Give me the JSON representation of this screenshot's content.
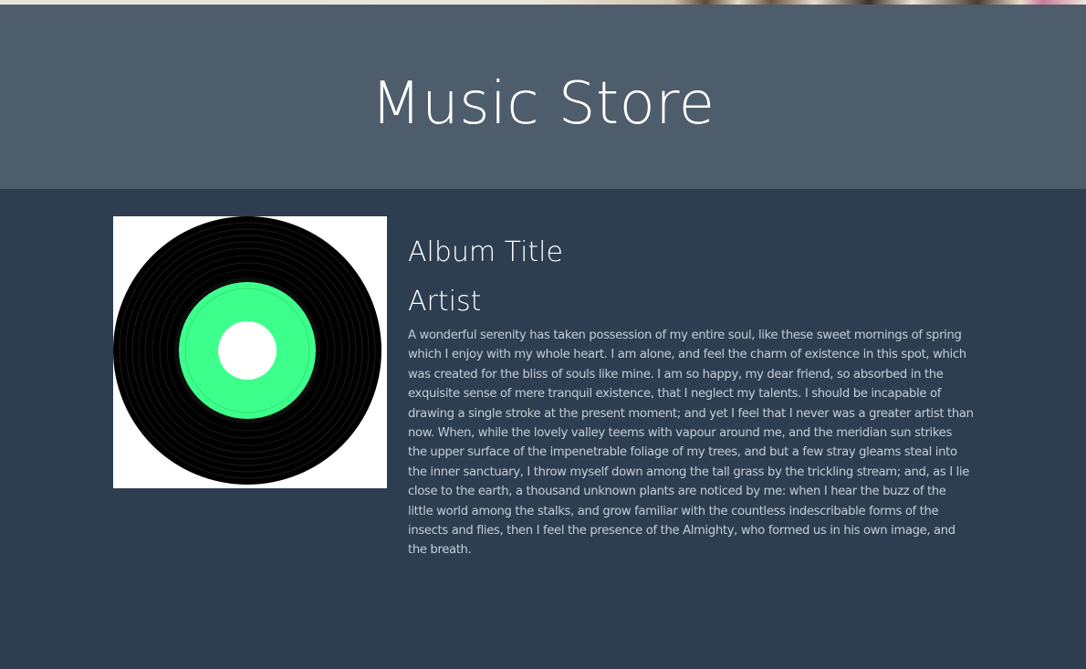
{
  "page": {
    "store_title": "Music Store"
  },
  "album": {
    "title": "Album Title",
    "artist": "Artist",
    "description": "A wonderful serenity has taken possession of my entire soul, like these sweet mornings of spring which I enjoy with my whole heart. I am alone, and feel the charm of existence in this spot, which was created for the bliss of souls like mine. I am so happy, my dear friend, so absorbed in the exquisite sense of mere tranquil existence, that I neglect my talents. I should be incapable of drawing a single stroke at the present moment; and yet I feel that I never was a greater artist than now. When, while the lovely valley teems with vapour around me, and the meridian sun strikes the upper surface of the impenetrable foliage of my trees, and but a few stray gleams steal into the inner sanctuary, I throw myself down among the tall grass by the trickling stream; and, as I lie close to the earth, a thousand unknown plants are noticed by me: when I hear the buzz of the little world among the stalks, and grow familiar with the countless indescribable forms of the insects and flies, then I feel the presence of the Almighty, who formed us in his own image, and the breath.",
    "cover_icon": "vinyl-record-icon"
  },
  "colors": {
    "header_bg": "#4e5d6c",
    "main_bg": "#2c3e50",
    "record_label": "#3dff8c",
    "text_light": "#ffffff",
    "text_body": "#c5cdd6"
  }
}
